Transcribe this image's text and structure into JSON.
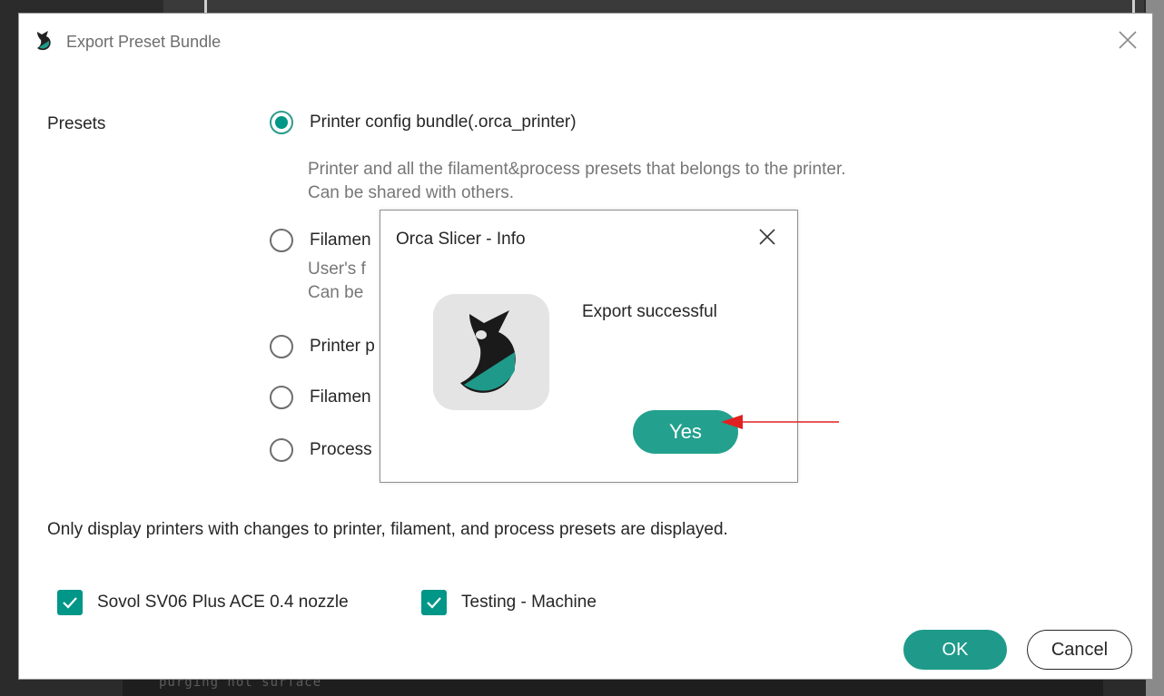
{
  "background": {
    "terminal_text": "purging not surface"
  },
  "dialog": {
    "title": "Export Preset Bundle",
    "presets_label": "Presets",
    "options": [
      {
        "label": "Printer config bundle(.orca_printer)",
        "selected": true
      },
      {
        "label": "Filamen",
        "selected": false
      },
      {
        "label": "Printer p",
        "selected": false
      },
      {
        "label": "Filamen",
        "selected": false
      },
      {
        "label": "Process",
        "selected": false
      }
    ],
    "option_descriptions": {
      "printer_bundle_line1": "Printer and all the filament&process presets that belongs to the printer.",
      "printer_bundle_line2": "Can be shared with others.",
      "filament_line1": "User's f",
      "filament_line2": "Can be"
    },
    "note": "Only display printers with changes to printer, filament, and process presets are displayed.",
    "printers": [
      {
        "label": "Sovol SV06 Plus ACE 0.4 nozzle",
        "checked": true
      },
      {
        "label": "Testing - Machine",
        "checked": true
      }
    ],
    "ok_label": "OK",
    "cancel_label": "Cancel"
  },
  "info_dialog": {
    "title": "Orca Slicer - Info",
    "message": "Export successful",
    "yes_label": "Yes"
  },
  "colors": {
    "accent": "#009688",
    "button": "#1f9a8a",
    "annotation_arrow": "#e02020"
  },
  "icons": {
    "app": "orca-slicer-logo-icon",
    "close": "close-icon",
    "check": "checkmark-icon",
    "arrow": "red-arrow-annotation"
  }
}
